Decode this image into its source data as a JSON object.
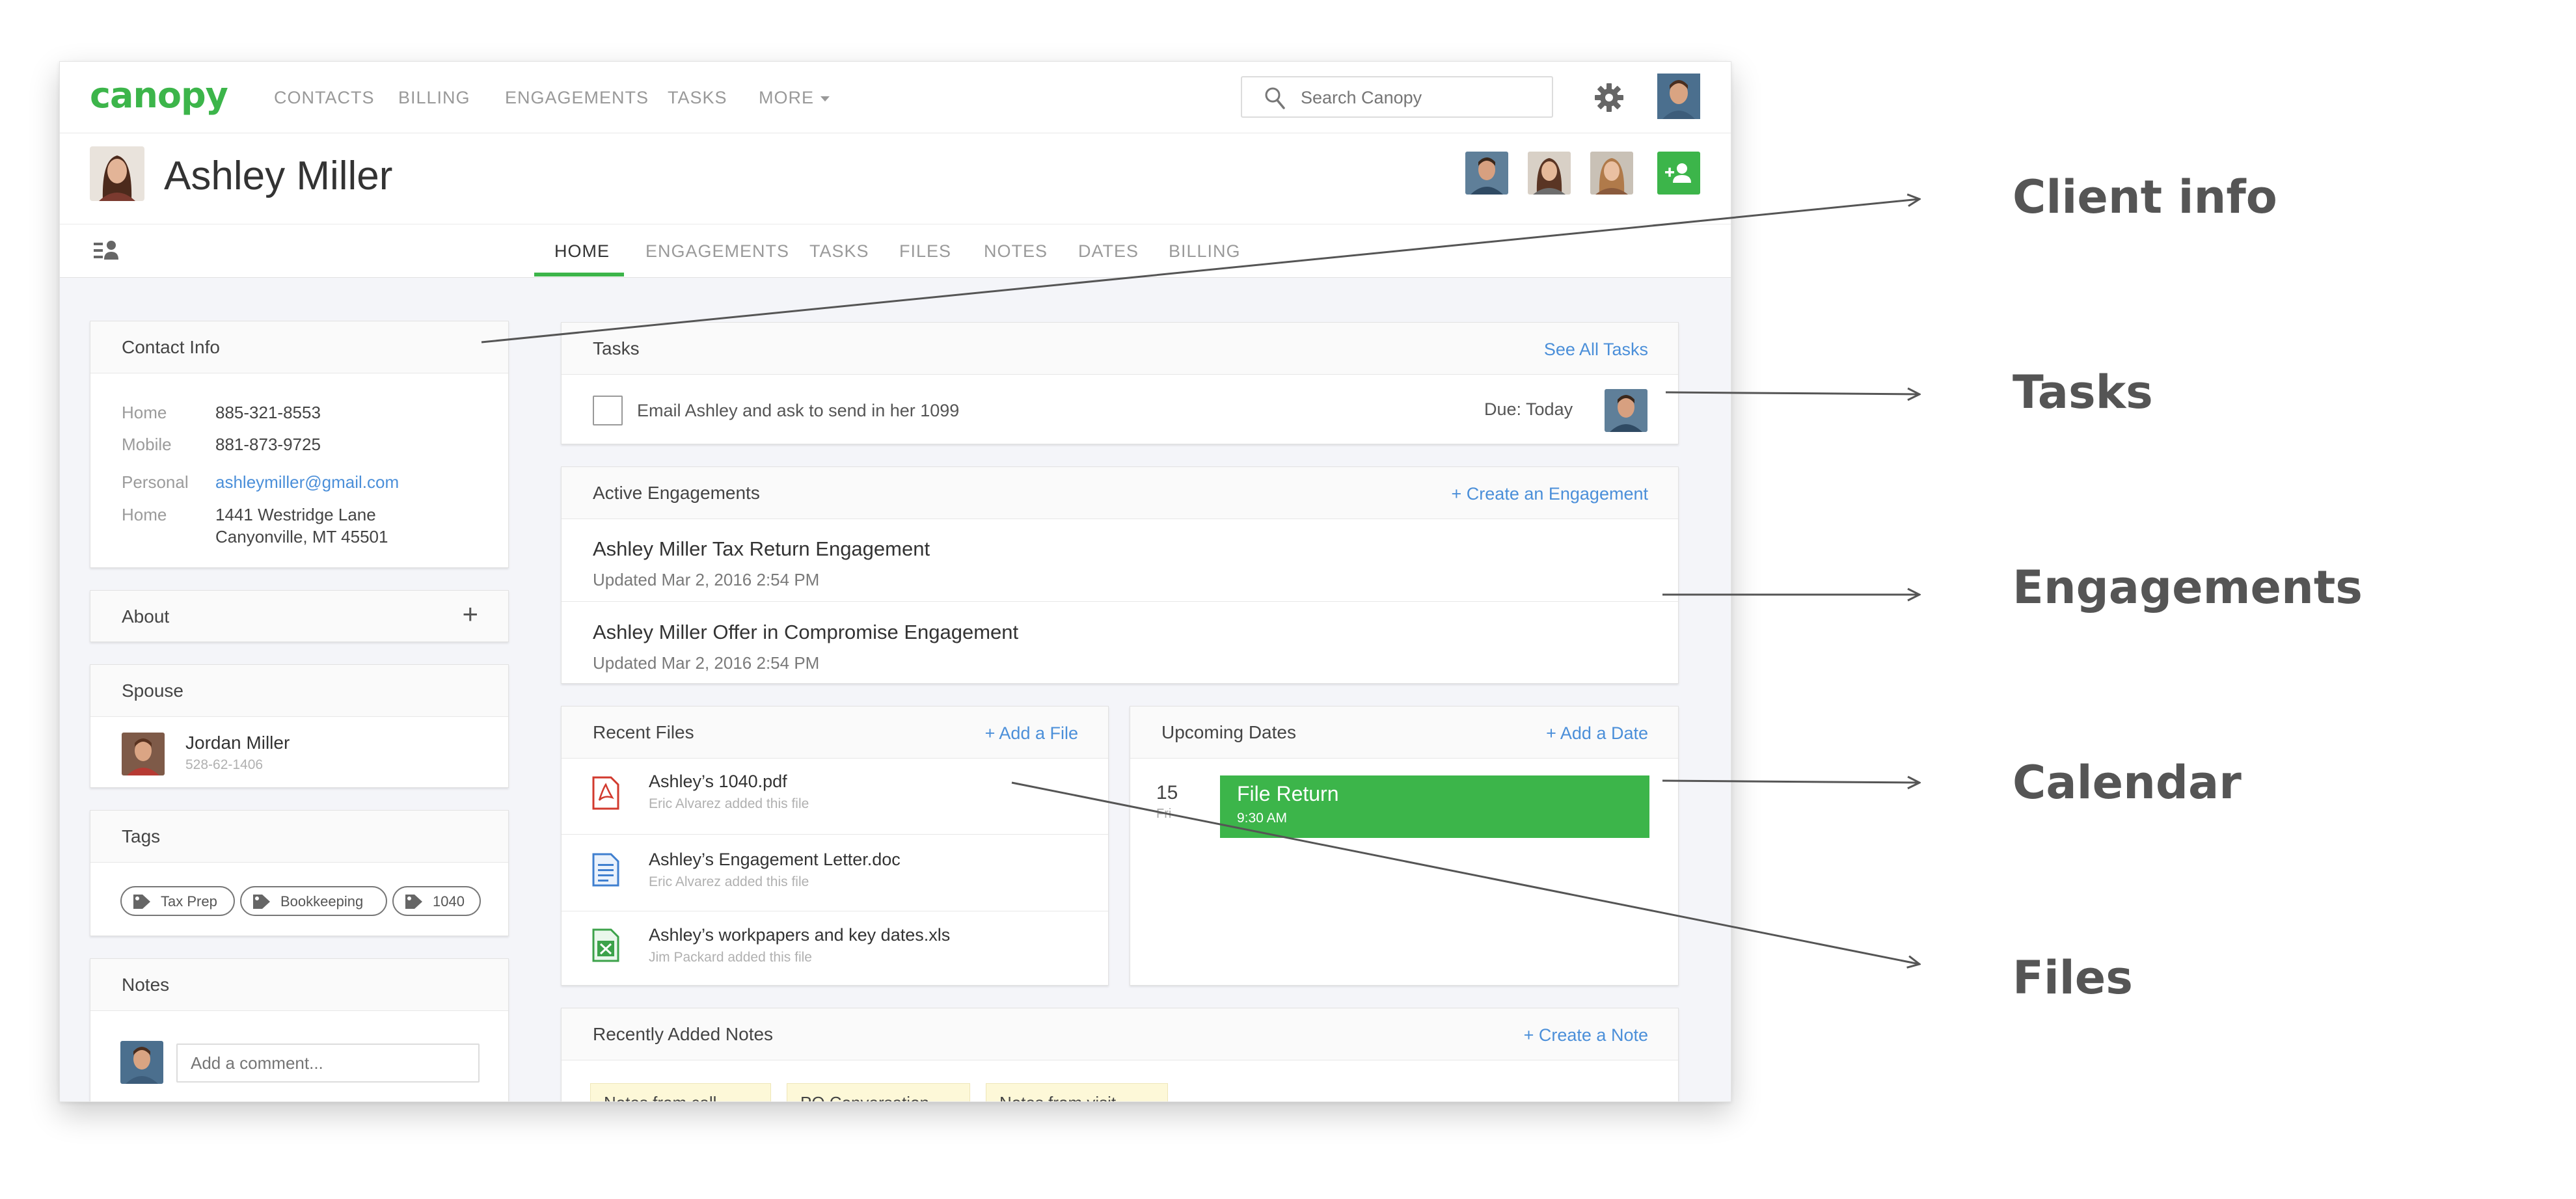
{
  "app": {
    "logo": "canopy",
    "nav": [
      "CONTACTS",
      "BILLING",
      "ENGAGEMENTS",
      "TASKS",
      "MORE"
    ],
    "search_placeholder": "Search Canopy"
  },
  "client": {
    "name": "Ashley Miller"
  },
  "tabs": [
    "HOME",
    "ENGAGEMENTS",
    "TASKS",
    "FILES",
    "NOTES",
    "DATES",
    "BILLING"
  ],
  "active_tab": "HOME",
  "contact_info": {
    "title": "Contact Info",
    "rows": [
      {
        "label": "Home",
        "value": "885-321-8553"
      },
      {
        "label": "Mobile",
        "value": "881-873-9725"
      },
      {
        "label": "Personal",
        "value": "ashleymiller@gmail.com"
      },
      {
        "label": "Home",
        "value": "1441 Westridge Lane",
        "value2": "Canyonville, MT 45501"
      }
    ]
  },
  "about": {
    "title": "About",
    "add_symbol": "+"
  },
  "spouse": {
    "title": "Spouse",
    "name": "Jordan Miller",
    "ssn": "528-62-1406"
  },
  "tags": {
    "title": "Tags",
    "items": [
      "Tax Prep",
      "Bookkeeping",
      "1040"
    ]
  },
  "notes_side": {
    "title": "Notes",
    "placeholder": "Add a comment..."
  },
  "tasks": {
    "title": "Tasks",
    "link": "See All Tasks",
    "items": [
      {
        "text": "Email Ashley and ask to send in her 1099",
        "due": "Due: Today"
      }
    ]
  },
  "engagements": {
    "title": "Active Engagements",
    "link": "+ Create an Engagement",
    "items": [
      {
        "name": "Ashley Miller Tax Return Engagement",
        "updated": "Updated Mar 2, 2016 2:54 PM"
      },
      {
        "name": "Ashley Miller Offer in Compromise Engagement",
        "updated": "Updated Mar 2, 2016 2:54 PM"
      }
    ]
  },
  "files": {
    "title": "Recent Files",
    "link": "+ Add a File",
    "items": [
      {
        "name": "Ashley’s 1040.pdf",
        "by": "Eric Alvarez added this file",
        "type": "pdf-icon",
        "color": "#d23a2e"
      },
      {
        "name": "Ashley’s Engagement Letter.doc",
        "by": "Eric Alvarez added this file",
        "type": "doc-icon",
        "color": "#3f7fcf"
      },
      {
        "name": "Ashley’s workpapers and key dates.xls",
        "by": "Jim Packard added this file",
        "type": "xls-icon",
        "color": "#3ca24a"
      }
    ]
  },
  "dates": {
    "title": "Upcoming Dates",
    "link": "+ Add a Date",
    "items": [
      {
        "day": "15",
        "weekday": "Fri",
        "event": "File Return",
        "time": "9:30 AM"
      }
    ]
  },
  "recent_notes": {
    "title": "Recently Added Notes",
    "link": "+ Create a Note",
    "items": [
      "Notes from call",
      "PO Conversation",
      "Notes from visit"
    ]
  },
  "annotations": [
    "Client info",
    "Tasks",
    "Engagements",
    "Calendar",
    "Files"
  ],
  "colors": {
    "brand_green": "#3cb54a",
    "link_blue": "#4b8fd9",
    "page_bg": "#f4f5f9"
  }
}
